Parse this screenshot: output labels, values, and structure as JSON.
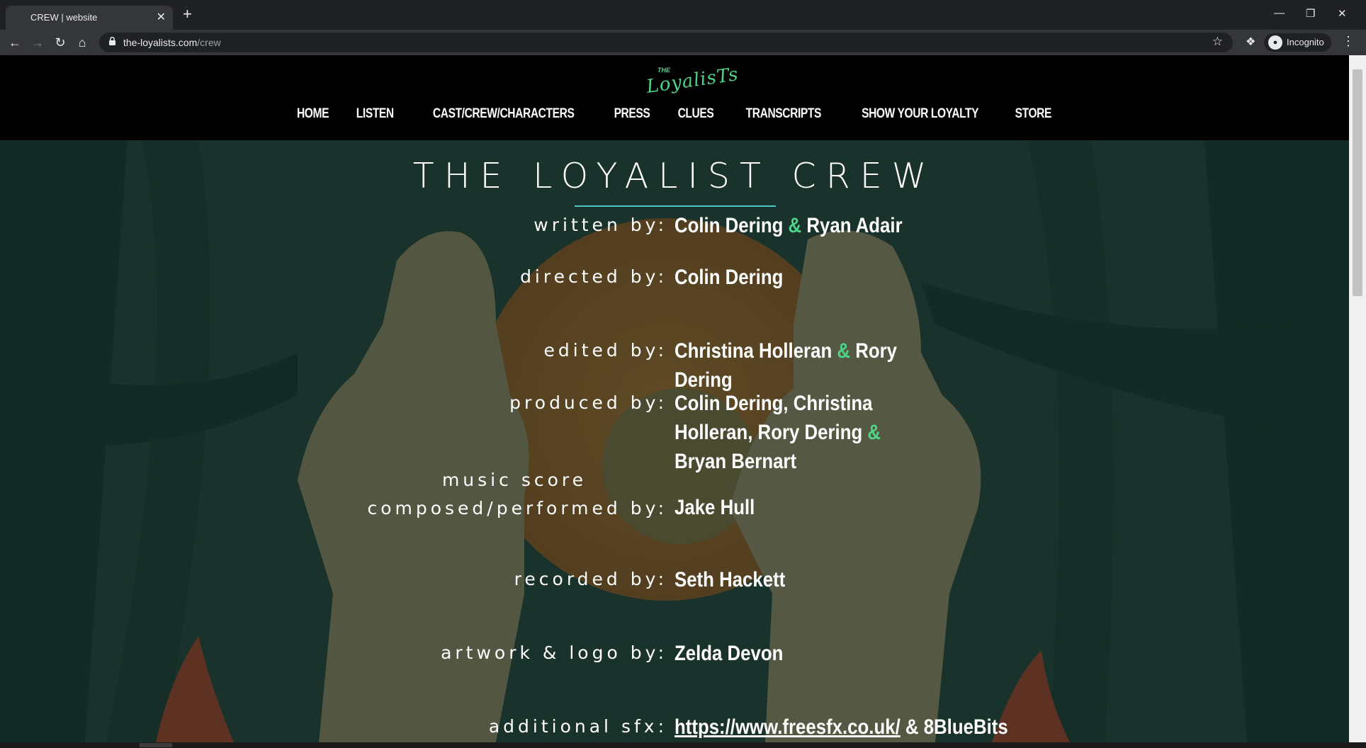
{
  "browser": {
    "tab_title": "CREW | website",
    "tab_close": "✕",
    "new_tab": "+",
    "url_host": "the-loyalists.com",
    "url_path": "/crew",
    "incognito_label": "Incognito",
    "window_controls": {
      "minimize": "—",
      "restore": "❐",
      "close": "✕"
    }
  },
  "site": {
    "logo_top": "THE",
    "logo_main": "LoyalisTs",
    "nav": [
      "HOME",
      "LISTEN",
      "CAST/CREW/CHARACTERS",
      "PRESS",
      "CLUES",
      "TRANSCRIPTS",
      "SHOW YOUR LOYALTY",
      "STORE"
    ]
  },
  "page": {
    "title": "THE LOYALIST CREW",
    "credits": [
      {
        "label": "written by:",
        "name_a": "Colin Dering",
        "amp": "&",
        "name_b": "Ryan Adair"
      },
      {
        "label": "directed by:",
        "name_a": "Colin Dering"
      },
      {
        "label": "edited by:",
        "name_a": "Christina Holleran",
        "amp": "&",
        "name_b": "Rory Dering"
      },
      {
        "label": "produced by:",
        "name_a": "Colin Dering, Christina Holleran, Rory Dering",
        "amp": "&",
        "name_b": "Bryan Bernart"
      },
      {
        "label_line1": "music score",
        "label_line2": "composed/performed by:",
        "name_a": "Jake Hull"
      },
      {
        "label": "recorded by:",
        "name_a": "Seth Hackett"
      },
      {
        "label": "artwork & logo by:",
        "name_a": "Zelda Devon"
      },
      {
        "label": "additional sfx:",
        "link": "https://www.freesfx.co.uk/",
        "tail": " & 8BlueBits"
      }
    ]
  },
  "colors": {
    "accent_green": "#4fd389",
    "title_rule": "#4cc8c0",
    "header_bg": "#000000",
    "chrome_bg": "#35363a"
  }
}
